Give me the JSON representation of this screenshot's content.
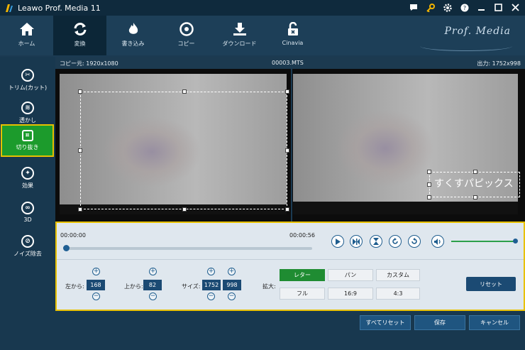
{
  "window": {
    "title": "Leawo Prof. Media 11"
  },
  "nav": {
    "items": [
      {
        "label": "ホーム",
        "icon": "home-icon"
      },
      {
        "label": "変換",
        "icon": "convert-icon"
      },
      {
        "label": "書き込み",
        "icon": "burn-icon"
      },
      {
        "label": "コピー",
        "icon": "copy-icon"
      },
      {
        "label": "ダウンロード",
        "icon": "download-icon"
      },
      {
        "label": "Cinavia",
        "icon": "lock-icon"
      }
    ],
    "brand": "Prof. Media"
  },
  "sidebar": {
    "items": [
      {
        "label": "トリム(カット)",
        "icon": "trim-icon"
      },
      {
        "label": "透かし",
        "icon": "watermark-icon"
      },
      {
        "label": "切り抜き",
        "icon": "crop-icon"
      },
      {
        "label": "効果",
        "icon": "effect-icon"
      },
      {
        "label": "3D",
        "icon": "3d-icon"
      },
      {
        "label": "ノイズ除去",
        "icon": "denoise-icon"
      }
    ]
  },
  "info": {
    "source": "コピー元: 1920x1080",
    "file": "00003.MTS",
    "output": "出力: 1752x998"
  },
  "preview": {
    "overlay_text": "すくすパピックス"
  },
  "player": {
    "current_time": "00:00:00",
    "end_time": "00:00:56",
    "progress": 0
  },
  "crop": {
    "left_label": "左から:",
    "left_value": "168",
    "top_label": "上から:",
    "top_value": "82",
    "size_label": "サイズ:",
    "width_value": "1752",
    "height_value": "998",
    "zoom_label": "拡大:",
    "options": [
      "レター",
      "パン",
      "カスタム",
      "フル",
      "16:9",
      "4:3"
    ],
    "selected_option": "レター",
    "reset_label": "リセット"
  },
  "footer": {
    "reset_all": "すべてリセット",
    "save": "保存",
    "cancel": "キャンセル"
  },
  "colors": {
    "accent_green": "#1c9b2c",
    "highlight_border": "#e7c000",
    "navy": "#1b4a73"
  }
}
